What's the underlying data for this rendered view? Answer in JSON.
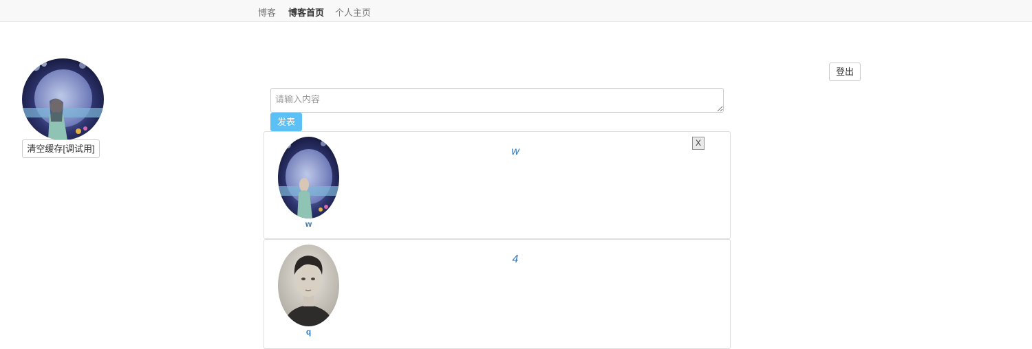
{
  "nav": {
    "brand": "博客",
    "items": [
      {
        "label": "博客首页",
        "active": true
      },
      {
        "label": "个人主页",
        "active": false
      }
    ]
  },
  "sidebar": {
    "avatar_icon": "user-avatar-moon-icon",
    "clear_cache_label": "清空缓存[调试用]"
  },
  "header": {
    "logout_label": "登出"
  },
  "composer": {
    "placeholder": "请输入内容",
    "value": "",
    "publish_label": "发表"
  },
  "posts": [
    {
      "author": "w",
      "content": "w",
      "avatar_icon": "user-avatar-moon-icon",
      "delete_label": "X",
      "can_delete": true
    },
    {
      "author": "q",
      "content": "4",
      "avatar_icon": "user-avatar-portrait-icon",
      "can_delete": false
    }
  ],
  "colors": {
    "link": "#337ab7",
    "publish_button": "#5bc0f5",
    "navbar_bg": "#f8f8f8"
  }
}
